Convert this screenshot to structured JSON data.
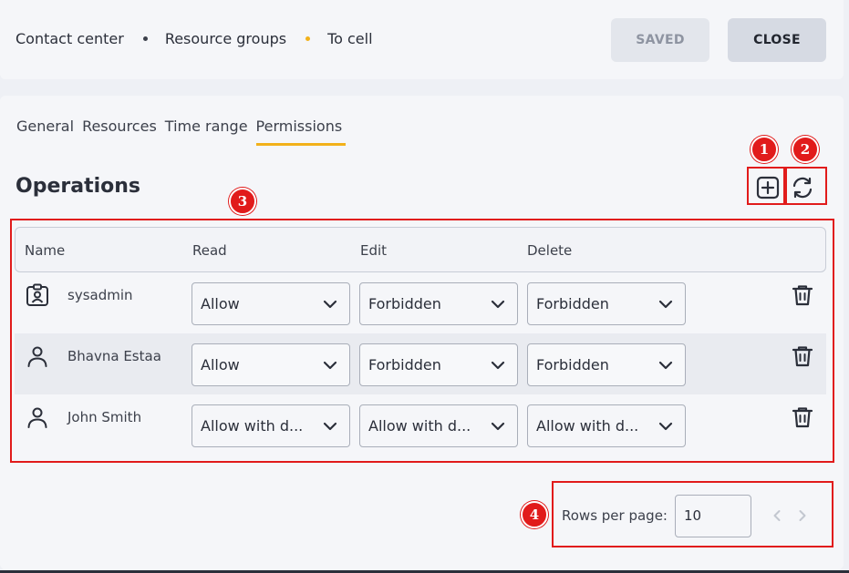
{
  "breadcrumb": {
    "items": [
      "Contact center",
      "Resource groups",
      "To cell"
    ],
    "dot_colors": [
      "#3c404b",
      "#f2b11a"
    ]
  },
  "header": {
    "saved_label": "SAVED",
    "close_label": "CLOSE"
  },
  "tabs": [
    {
      "label": "General",
      "active": false
    },
    {
      "label": "Resources",
      "active": false
    },
    {
      "label": "Time range",
      "active": false
    },
    {
      "label": "Permissions",
      "active": true
    }
  ],
  "section": {
    "title": "Operations",
    "add_icon": "plus-square-icon",
    "refresh_icon": "refresh-icon"
  },
  "table": {
    "columns": [
      "Name",
      "Read",
      "Edit",
      "Delete"
    ],
    "rows": [
      {
        "icon": "id-badge-icon",
        "name": "sysadmin",
        "read": "Allow",
        "edit": "Forbidden",
        "delete": "Forbidden"
      },
      {
        "icon": "user-icon",
        "name": "Bhavna Estaa",
        "read": "Allow",
        "edit": "Forbidden",
        "delete": "Forbidden"
      },
      {
        "icon": "user-icon",
        "name": "John Smith",
        "read": "Allow with d...",
        "edit": "Allow with d...",
        "delete": "Allow with d..."
      }
    ]
  },
  "pager": {
    "rows_label": "Rows per page:",
    "rows_value": "10"
  },
  "callouts": [
    "1",
    "2",
    "3",
    "4"
  ],
  "colors": {
    "accent": "#f2b11a",
    "callout": "#e11b1b"
  }
}
